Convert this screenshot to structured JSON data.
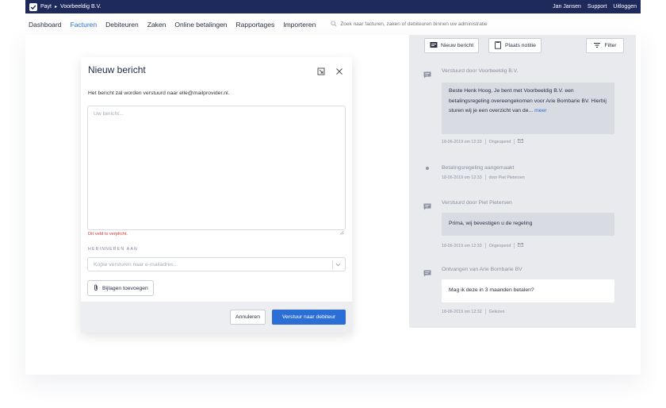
{
  "topbar": {
    "app_name": "Payt",
    "company": "Voorbeeldig B.V.",
    "user": "Jan Jansen",
    "support": "Support",
    "logout": "Uitloggen"
  },
  "nav": {
    "items": [
      "Dashboard",
      "Facturen",
      "Debiteuren",
      "Zaken",
      "Online betalingen",
      "Rapportages",
      "Importeren"
    ],
    "active_index": 1,
    "search_placeholder": "Zoek naar facturen, zaken of debiteuren binnen uw administratie"
  },
  "modal": {
    "title": "Nieuw bericht",
    "subtitle": "Het bericht zal worden verstuurd naar elle@mailprovider.nl.",
    "message_placeholder": "Uw bericht...",
    "error": "Dit veld is verplicht.",
    "reminder_label": "HERINNEREN AAN",
    "copy_placeholder": "Kopie versturen naar e-mailadres...",
    "attach_label": "Bijlagen toevoegen",
    "cancel_label": "Annuleren",
    "send_label": "Verstuur naar debiteur"
  },
  "panel": {
    "new_message_label": "Nieuw bericht",
    "add_note_label": "Plaats notitie",
    "filter_label": "Filter",
    "events": [
      {
        "title": "Verstuurd door Voorbeeldig B.V.",
        "body": "Beste Henk Hoog, Je bent met Voorbeeldig B.V. een betalingsregeling overeengekomen voor Arie Bombarie BV. Hierbij sturen wij je een overzicht van de...",
        "more": "meer",
        "date": "18-06-2019 om 12:33",
        "status": "Ongeopend"
      },
      {
        "title": "Betalingsregeling aangemaakt",
        "date": "18-06-2019 om 12:33",
        "author": "door Piet Pietersen"
      },
      {
        "title": "Verstuurd door Piet Pietersen",
        "body": "Prima, wij bevestigen u de regeling",
        "date": "18-06-2019 om 12:33",
        "status": "Ongeopend"
      },
      {
        "title": "Ontvangen van Arie Bombarie BV",
        "body": "Mag ik deze in 3 maanden betalen?",
        "date": "18-06-2019 om 12:32",
        "status": "Gelezen"
      }
    ]
  },
  "colors": {
    "topbar": "#1f2a5c",
    "accent": "#2b6fd6",
    "error": "#d9363e",
    "panel_bg": "#e9eaee"
  }
}
